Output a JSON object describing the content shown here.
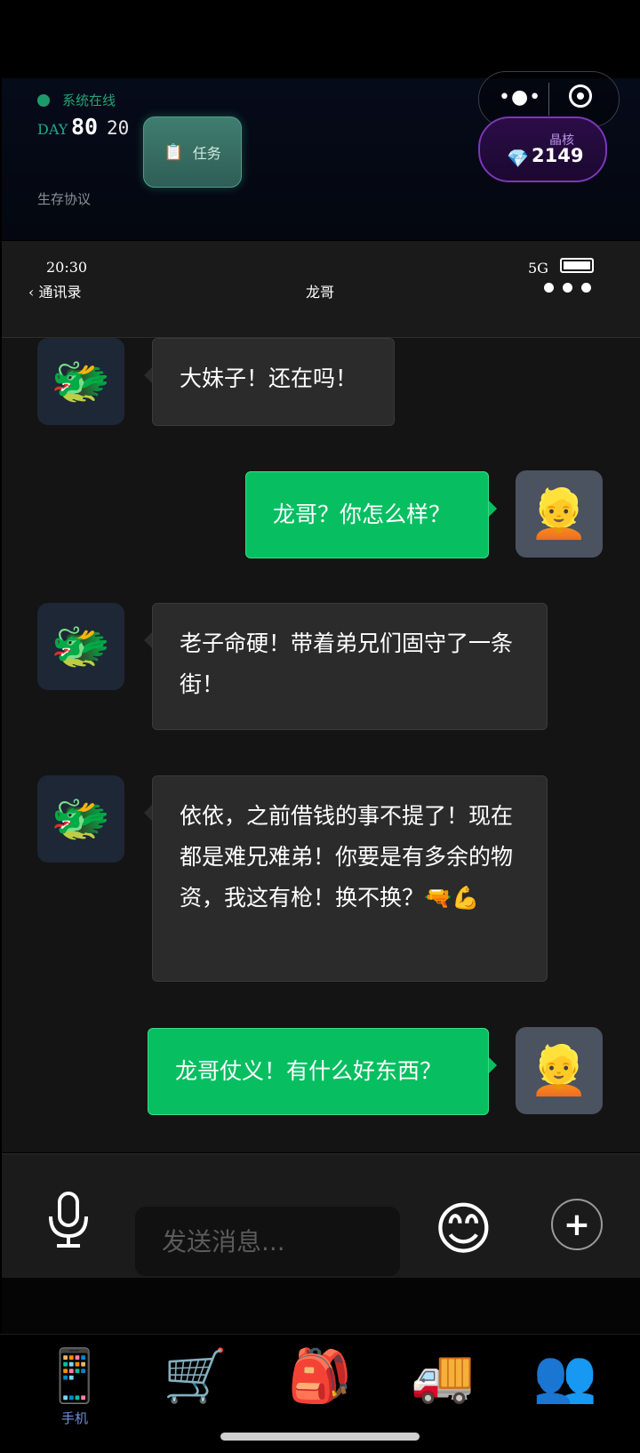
{
  "top": {
    "online_label": "系统在线",
    "day_label": "DAY",
    "day_value": "80",
    "day_sub": "20",
    "protocol_label": "生存协议",
    "task_label": "任务",
    "task_icon": "clipboard-icon",
    "crystal_label": "晶核",
    "crystal_value": "2149",
    "crystal_icon": "gem-icon",
    "colors": {
      "online": "#1e9a6a",
      "crystal_border": "#7b37b8",
      "task_bg": "#3f7d70"
    }
  },
  "phone": {
    "time": "20:30",
    "network": "5G",
    "back_label": "通讯录",
    "contact_name": "龙哥"
  },
  "messages": [
    {
      "side": "in",
      "avatar": "dragon-face-icon",
      "text": "大妹子！还在吗！"
    },
    {
      "side": "out",
      "avatar": "person-blond-icon",
      "text": "龙哥？你怎么样？"
    },
    {
      "side": "in",
      "avatar": "dragon-face-icon",
      "text": "老子命硬！带着弟兄们固守了一条街！"
    },
    {
      "side": "in",
      "avatar": "dragon-face-icon",
      "text": "依依，之前借钱的事不提了！现在都是难兄难弟！你要是有多余的物资，我这有枪！换不换？🔫💪"
    },
    {
      "side": "out",
      "avatar": "person-blond-icon",
      "text": "龙哥仗义！有什么好东西？"
    }
  ],
  "input": {
    "placeholder": "发送消息...",
    "colors": {
      "out_bubble": "#07bf61",
      "in_bubble": "#2b2b2b"
    }
  },
  "nav": {
    "items": [
      {
        "icon": "mobile-phone-icon",
        "label": "手机",
        "active": true
      },
      {
        "icon": "shopping-cart-icon",
        "label": ""
      },
      {
        "icon": "backpack-icon",
        "label": ""
      },
      {
        "icon": "delivery-truck-icon",
        "label": ""
      },
      {
        "icon": "people-silhouette-icon",
        "label": ""
      }
    ],
    "active_color": "#6f8fd8"
  }
}
